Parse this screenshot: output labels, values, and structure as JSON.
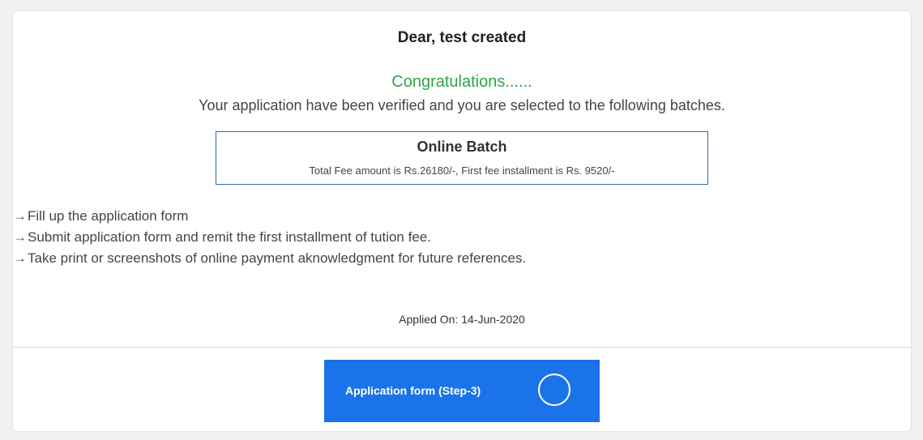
{
  "header": {
    "greeting": "Dear, test created"
  },
  "message": {
    "congrats": "Congratulations......",
    "verified": "Your application have been verified and you are selected to the following batches."
  },
  "batch": {
    "title": "Online Batch",
    "fee_text": "Total Fee amount is Rs.26180/-, First fee installment is Rs. 9520/-"
  },
  "instructions": {
    "arrow_glyph": "→",
    "items": [
      "Fill up the application form",
      "Submit application form and remit the first installment of tution fee.",
      "Take print or screenshots of online payment aknowledgment for future references."
    ]
  },
  "applied": {
    "text": "Applied On: 14-Jun-2020"
  },
  "action": {
    "button_label": "Application form (Step-3)",
    "button_color": "#1a73e8",
    "loading_icon": "spinner-icon"
  },
  "colors": {
    "success": "#2ea44a",
    "batch_border": "#2d6aa8"
  }
}
